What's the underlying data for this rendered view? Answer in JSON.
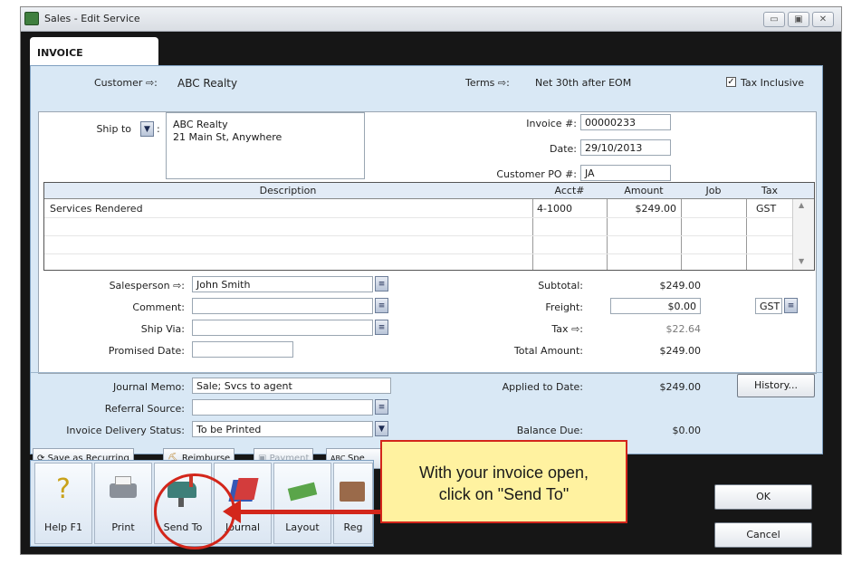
{
  "window": {
    "title": "Sales - Edit Service",
    "controls": [
      "▭",
      "▣",
      "✕"
    ]
  },
  "tab": {
    "label": "INVOICE"
  },
  "header": {
    "customer_label": "Customer",
    "customer_value": "ABC Realty",
    "terms_label": "Terms",
    "terms_value": "Net 30th after EOM",
    "tax_inclusive_label": "Tax Inclusive",
    "tax_inclusive_checked": true
  },
  "shipto": {
    "label": "Ship to",
    "lines": [
      "ABC Realty",
      "21 Main St, Anywhere"
    ]
  },
  "invoice_info": {
    "invoice_no_label": "Invoice #:",
    "invoice_no": "00000233",
    "date_label": "Date:",
    "date": "29/10/2013",
    "po_label": "Customer PO #:",
    "po": "JA"
  },
  "table": {
    "headers": [
      "Description",
      "Acct#",
      "Amount",
      "Job",
      "Tax"
    ],
    "rows": [
      {
        "description": "Services Rendered",
        "acct": "4-1000",
        "amount": "$249.00",
        "job": "",
        "tax": "GST"
      }
    ]
  },
  "details": {
    "salesperson_label": "Salesperson",
    "salesperson": "John Smith",
    "comment_label": "Comment:",
    "comment": "",
    "ship_via_label": "Ship Via:",
    "ship_via": "",
    "promised_date_label": "Promised Date:",
    "promised_date": ""
  },
  "totals": {
    "subtotal_label": "Subtotal:",
    "subtotal": "$249.00",
    "freight_label": "Freight:",
    "freight": "$0.00",
    "freight_tax": "GST",
    "tax_label": "Tax",
    "tax": "$22.64",
    "total_label": "Total Amount:",
    "total": "$249.00"
  },
  "memo": {
    "journal_memo_label": "Journal Memo:",
    "journal_memo": "Sale; Svcs to agent",
    "referral_label": "Referral Source:",
    "referral": "",
    "delivery_label": "Invoice Delivery Status:",
    "delivery": "To be Printed",
    "applied_label": "Applied to Date:",
    "applied": "$249.00",
    "history_button": "History...",
    "balance_label": "Balance Due:",
    "balance": "$0.00"
  },
  "action_buttons": {
    "save_recurring": "Save as Recurring",
    "reimburse": "Reimburse",
    "payment": "Payment",
    "spell": "Spe"
  },
  "toolbar": {
    "help": "Help F1",
    "print": "Print",
    "send_to": "Send To",
    "journal": "Journal",
    "layout": "Layout",
    "register": "Reg"
  },
  "dialog_buttons": {
    "ok": "OK",
    "cancel": "Cancel"
  },
  "callout": {
    "line1": "With your invoice open,",
    "line2": "click on \"Send To\""
  },
  "colors": {
    "callout_bg": "#fff2a0",
    "callout_border": "#d3261b",
    "panel_blue": "#d9e8f5"
  }
}
